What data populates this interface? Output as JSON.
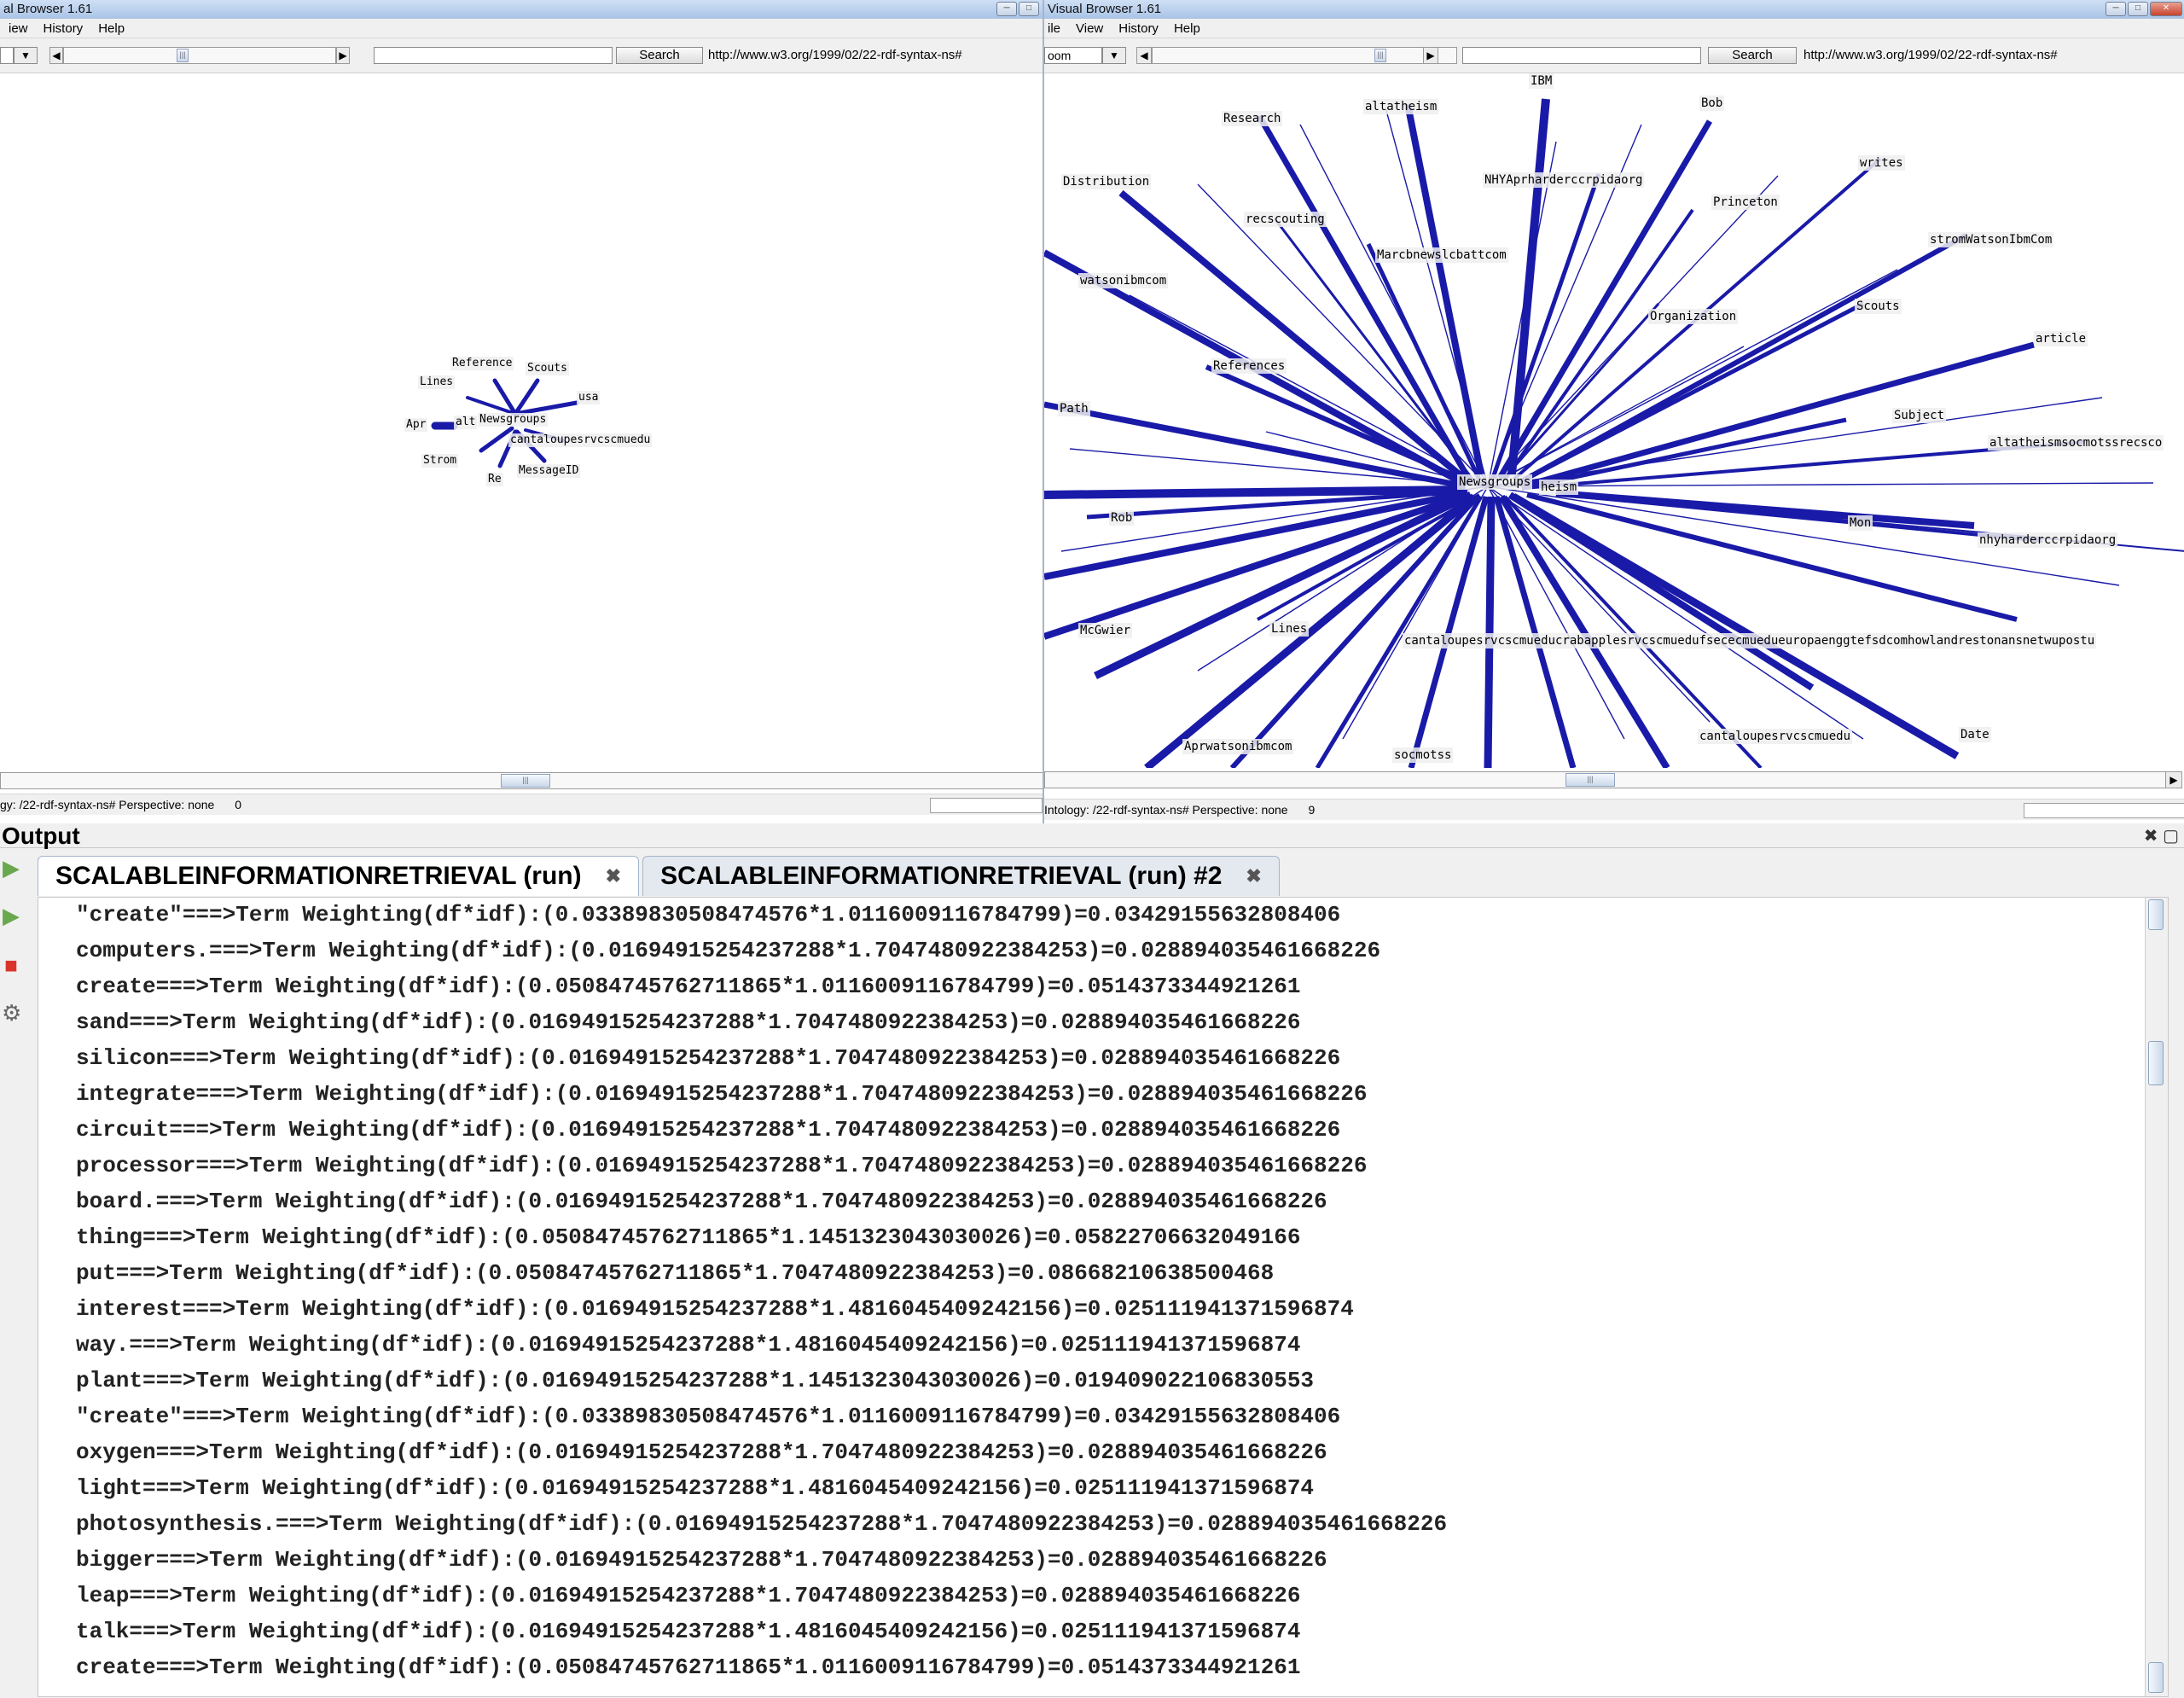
{
  "left_window": {
    "title": "al Browser 1.61",
    "menu": [
      "iew",
      "History",
      "Help"
    ],
    "search_label": "Search",
    "url": "http://www.w3.org/1999/02/22-rdf-syntax-ns#",
    "graph_nodes": {
      "reference": "Reference",
      "scouts": "Scouts",
      "lines": "Lines",
      "usa": "usa",
      "apr": "Apr",
      "alt": "alt",
      "newsgroups": "Newsgroups",
      "cantaloupe": "cantaloupesrvcscmuedu",
      "strom": "Strom",
      "messageid": "MessageID",
      "re": "Re"
    },
    "status": "gy: /22-rdf-syntax-ns# Perspective: none",
    "status_count": "0"
  },
  "right_window": {
    "title": "Visual Browser 1.61",
    "menu": [
      "ile",
      "View",
      "History",
      "Help"
    ],
    "zoom_label": "oom",
    "search_label": "Search",
    "url": "http://www.w3.org/1999/02/22-rdf-syntax-ns#",
    "graph_nodes": {
      "ibm": "IBM",
      "altatheism": "altatheism",
      "research": "Research",
      "bob": "Bob",
      "writes": "writes",
      "distribution": "Distribution",
      "nhyaprharder": "NHYAprharderccrpidaorg",
      "princeton": "Princeton",
      "recscouting": "recscouting",
      "strom_watson": "stromWatsonIbmCom",
      "marcbnews": "Marcbnewslcbattcom",
      "watsonibmcom": "watsonibmcom",
      "organization": "Organization",
      "scouts": "Scouts",
      "article": "article",
      "references": "References",
      "path": "Path",
      "subject": "Subject",
      "altatheismsoc": "altatheismsocmotssrecsco",
      "newsgroups": "Newsgroups",
      "heism": "heism",
      "rob": "Rob",
      "mon": "Mon",
      "nhyharder": "nhyharderccrpidaorg",
      "mcgwier": "McGwier",
      "lines": "Lines",
      "cantaloupe_long": "cantaloupesrvcscmueducrabapplesrvcscmuedufsececmuedueuropaenggtefsdcomhowlandrestonansnetwupostu",
      "cantaloupe": "cantaloupesrvcscmuedu",
      "date": "Date",
      "aprwatson": "Aprwatsonibmcom",
      "socmotss": "socmotss"
    },
    "status": "Intology: /22-rdf-syntax-ns# Perspective: none",
    "status_count": "9"
  },
  "output": {
    "title": "Output",
    "tabs": [
      "SCALABLEINFORMATIONRETRIEVAL (run)",
      "SCALABLEINFORMATIONRETRIEVAL (run) #2"
    ],
    "lines": [
      "\"create\"===>Term Weighting(df*idf):(0.03389830508474576*1.011600911678479​9)=0.03429155632808406",
      "computers.===>Term Weighting(df*idf):(0.01694915254237288*1.7047480922384253)=0.028894035461668226",
      "create===>Term Weighting(df*idf):(0.05084745762711865*1.0116009116784799)=0.0514373344921261",
      "sand===>Term Weighting(df*idf):(0.01694915254237288*1.7047480922384253)=0.028894035461668226",
      "silicon===>Term Weighting(df*idf):(0.01694915254237288*1.7047480922384253)=0.028894035461668226",
      "integrate===>Term Weighting(df*idf):(0.01694915254237288*1.7047480922384253)=0.028894035461668226",
      "circuit===>Term Weighting(df*idf):(0.01694915254237288*1.7047480922384253)=0.028894035461668226",
      "processor===>Term Weighting(df*idf):(0.01694915254237288*1.7047480922384253)=0.028894035461668226",
      "board.===>Term Weighting(df*idf):(0.01694915254237288*1.7047480922384253)=0.028894035461668226",
      "thing===>Term Weighting(df*idf):(0.05084745762711865*1.1451323043030026)=0.05822706632049166",
      "put===>Term Weighting(df*idf):(0.05084745762711865*1.7047480922384253)=0.08668210638500468",
      "interest===>Term Weighting(df*idf):(0.01694915254237288*1.4816045409242156)=0.025111941371596874",
      "way.===>Term Weighting(df*idf):(0.01694915254237288*1.4816045409242156)=0.025111941371596874",
      "plant===>Term Weighting(df*idf):(0.01694915254237288*1.1451323043030026)=0.019409022106830553",
      "\"create\"===>Term Weighting(df*idf):(0.03389830508474576*1.0116009116784799)=0.03429155632808406",
      "oxygen===>Term Weighting(df*idf):(0.01694915254237288*1.7047480922384253)=0.028894035461668226",
      "light===>Term Weighting(df*idf):(0.01694915254237288*1.4816045409242156)=0.025111941371596874",
      "photosynthesis.===>Term Weighting(df*idf):(0.01694915254237288*1.7047480922384253)=0.028894035461668226",
      "bigger===>Term Weighting(df*idf):(0.01694915254237288*1.7047480922384253)=0.028894035461668226",
      "leap===>Term Weighting(df*idf):(0.01694915254237288*1.7047480922384253)=0.028894035461668226",
      "talk===>Term Weighting(df*idf):(0.01694915254237288*1.4816045409242156)=0.025111941371596874",
      "create===>Term Weighting(df*idf):(0.05084745762711865*1.0116009116784799)=0.0514373344921261"
    ]
  },
  "colors": {
    "edge": "#1a1aa8",
    "tab_border": "#a7b6cc"
  },
  "icons": [
    "run-icon",
    "rerun-icon",
    "stop-icon",
    "settings-icon",
    "tab-close-icon"
  ]
}
